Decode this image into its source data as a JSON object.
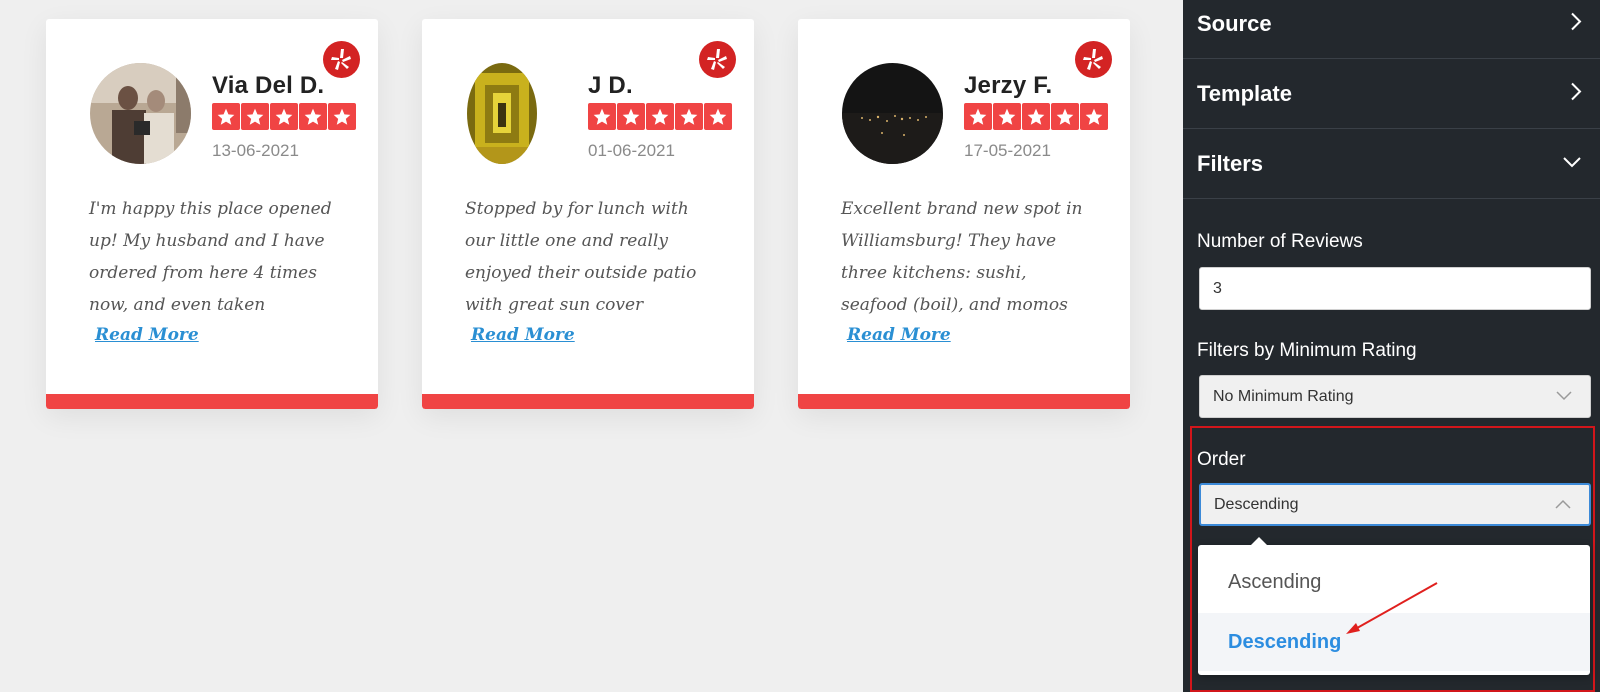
{
  "reviews": [
    {
      "name": "Via Del D.",
      "date": "13-06-2021",
      "rating": 5,
      "text": "I'm happy this place opened up! My husband and I have ordered from here 4 times now, and even taken",
      "read_more": "Read More"
    },
    {
      "name": "J D.",
      "date": "01-06-2021",
      "rating": 5,
      "text": "Stopped by for lunch with our little one and really enjoyed their outside patio with great sun cover",
      "read_more": "Read More"
    },
    {
      "name": "Jerzy F.",
      "date": "17-05-2021",
      "rating": 5,
      "text": "Excellent brand new spot in Williamsburg! They have three kitchens: sushi, seafood (boil), and momos",
      "read_more": "Read More"
    }
  ],
  "colors": {
    "accent_red": "#f04444",
    "yelp_red": "#d32323",
    "link_blue": "#2a8fd3",
    "panel_bg": "#23282d",
    "selected_blue": "#2c8de0",
    "annotation_red": "#d2161b"
  },
  "panel": {
    "sections": {
      "source": "Source",
      "template": "Template",
      "filters": "Filters"
    },
    "number_of_reviews": {
      "label": "Number of Reviews",
      "value": "3"
    },
    "min_rating": {
      "label": "Filters by Minimum Rating",
      "value": "No Minimum Rating"
    },
    "order": {
      "label": "Order",
      "value": "Descending",
      "options": [
        "Ascending",
        "Descending"
      ],
      "selected": "Descending"
    }
  },
  "icons": [
    "yelp-icon",
    "star-icon",
    "chevron-right-icon",
    "chevron-down-icon",
    "chevron-up-icon",
    "annotation-arrow"
  ]
}
